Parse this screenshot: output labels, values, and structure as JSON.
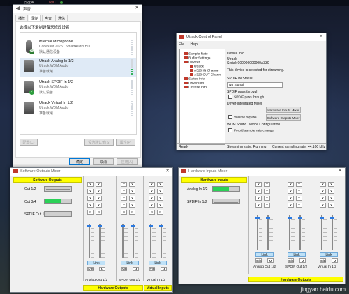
{
  "taskbar": {
    "item1": "立体声",
    "item2": "NyC"
  },
  "sound_dialog": {
    "title": "声音",
    "tabs": [
      "播放",
      "录制",
      "声音",
      "通信"
    ],
    "instruction": "选择以下录制设备来修改设置:",
    "devices": [
      {
        "name": "Internal Microphone",
        "line2": "Conexant 20751 SmartAudio HD",
        "line3": "默认通信设备",
        "icon": "microphone-icon",
        "badge": "phone",
        "level": 0
      },
      {
        "name": "Utrack Analog In 1/2",
        "line2": "Utrack WDM Audio",
        "line3": "准备就绪",
        "icon": "line-in-icon",
        "badge": "none",
        "level": 0.35
      },
      {
        "name": "Utrack SPDIF In 1/2",
        "line2": "Utrack WDM Audio",
        "line3": "默认设备",
        "icon": "line-in-icon",
        "badge": "check",
        "level": 0
      },
      {
        "name": "Utrack Virtual In 1/2",
        "line2": "Utrack WDM Audio",
        "line3": "准备就绪",
        "icon": "line-in-icon",
        "badge": "none",
        "level": 0
      }
    ],
    "configure_btn": "配置(C)",
    "set_default_btn": "设为默认值(S)",
    "properties_btn": "属性(P)",
    "ok_btn": "确定",
    "cancel_btn": "取消",
    "apply_btn": "应用(A)",
    "colors": {
      "selected_row": "#dfeaf6",
      "level_on": "#35b35a",
      "phone_badge": "#2e7d32",
      "check_badge": "#2e9e3e"
    }
  },
  "control_panel": {
    "title": "Utrack Control Panel",
    "menu": [
      "File",
      "Help"
    ],
    "tree": [
      "Sample Rate",
      "Buffer Settings",
      "Devices",
      "Utrack",
      "A320 IN Channe",
      "A320 OUT Chann",
      "Status Info",
      "Driver Info",
      "License Info"
    ],
    "device_info_header": "Device Info",
    "device_name": "Utrack",
    "serial": "Serial: 000000000000A330",
    "selected_note": "This device is selected for streaming.",
    "spdif_status_header": "SPDIF IN Status",
    "spdif_status": "No Signal",
    "spdif_pass_header": "SPDIF pass through",
    "spdif_pass_chk": "SPDIF pass through",
    "direct_mixer_header": "Driver-integrated Mixer",
    "volume_bypass": "Volume bypass",
    "hw_inputs_btn": "Hardware Inputs Mixer",
    "sw_outputs_btn": "Software Outputs Mixer",
    "wdm_header": "WDM Sound Device Configuration",
    "forbid_rate": "Forbid sample rate change",
    "status_ready": "Ready",
    "status_stream": "Streaming state: Running",
    "status_rate": "Current sampling rate: 44.100 kHz"
  },
  "sw_mixer": {
    "title": "Software Outputs Mixer",
    "top_bar": "Software Outputs",
    "rows": [
      {
        "label": "Out 1/2",
        "level": 0
      },
      {
        "label": "Out 3/4",
        "level": 0.62
      },
      {
        "label": "SPDIF Out 1/2",
        "level": 0
      }
    ],
    "x_label": "x",
    "columns": [
      {
        "label": "Analog Out 1/2",
        "link": "Link",
        "b1": "0dB",
        "b2": "M"
      },
      {
        "label": "SPDIF Out 1/2",
        "link": "Link",
        "b1": "0dB",
        "b2": "M"
      },
      {
        "label": "Virtual In 1/2",
        "link": "Link",
        "b1": "0dB",
        "b2": "M"
      }
    ],
    "bottom_bar1": "Hardware Outputs",
    "bottom_bar2": "Virtual Inputs"
  },
  "hw_mixer": {
    "title": "Hardware Inputs Mixer",
    "top_bar": "Hardware Inputs",
    "rows": [
      {
        "label": "Analog In 1/2",
        "level": 0.6
      },
      {
        "label": "SPDIF In 1/2",
        "level": 0
      }
    ],
    "x_label": "x",
    "columns": [
      {
        "label": "Analog Out 1/2",
        "link": "Link",
        "b1": "0dB",
        "b2": "M"
      },
      {
        "label": "SPDIF Out 1/2",
        "link": "Link",
        "b1": "0dB",
        "b2": "M"
      },
      {
        "label": "Virtual In 1/2",
        "link": "Link",
        "b1": "0dB",
        "b2": "M"
      }
    ],
    "bottom_bar": "Hardware Outputs"
  },
  "watermark": "jingyan.baidu.com"
}
